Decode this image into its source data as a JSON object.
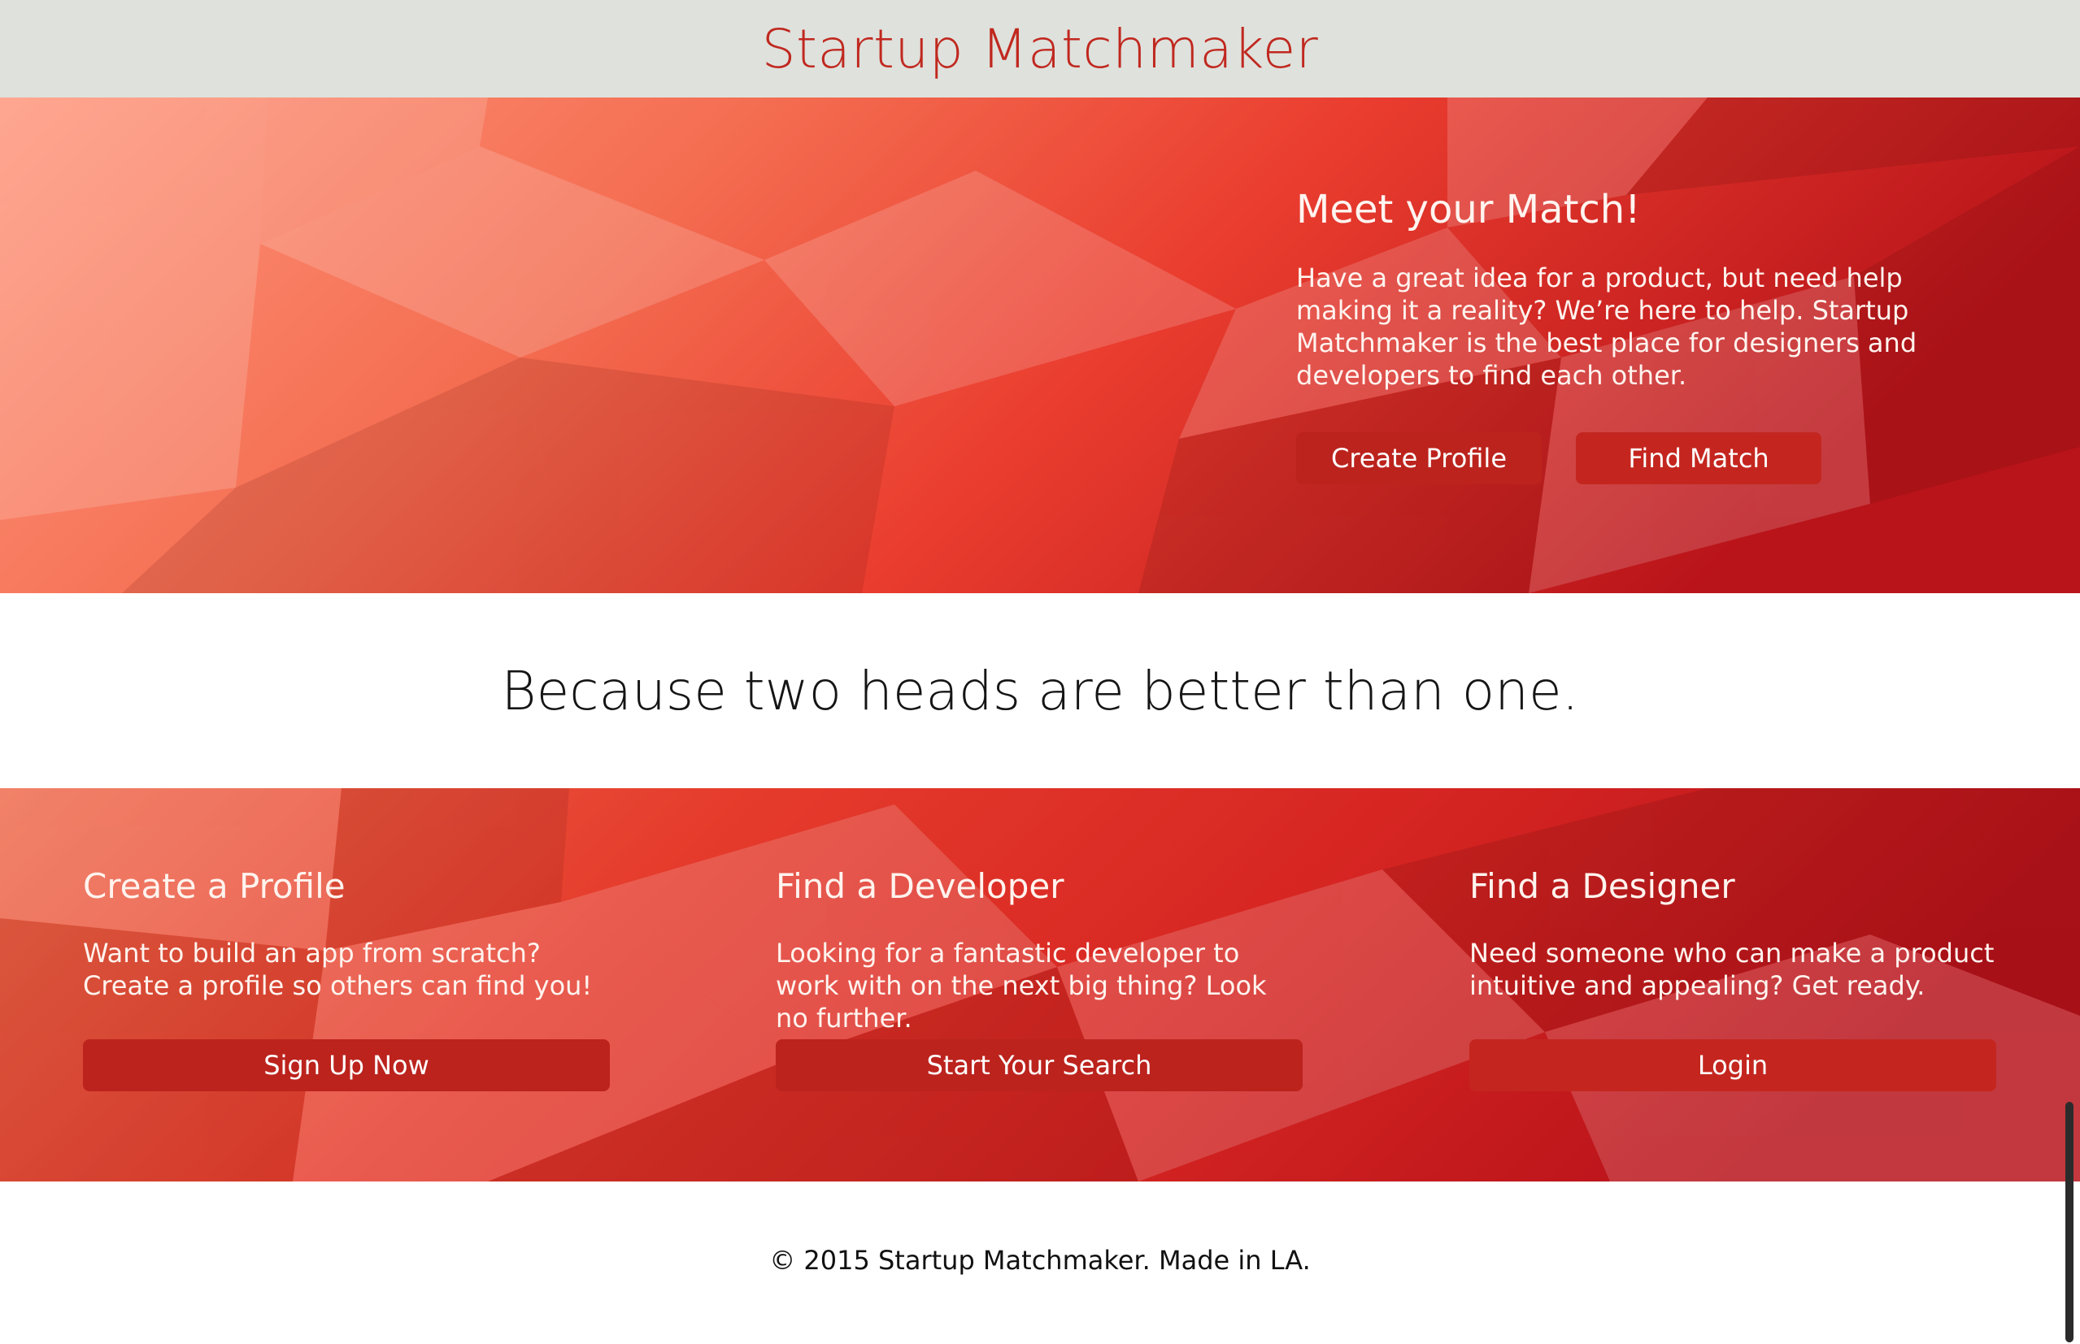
{
  "header": {
    "title": "Startup Matchmaker"
  },
  "hero": {
    "heading": "Meet your Match!",
    "text": "Have a great idea for a product, but need help making it a reality? We’re here to help. Startup Matchmaker is the best place for designers and developers to find each other.",
    "buttons": {
      "create_profile": "Create Profile",
      "find_match": "Find Match"
    }
  },
  "tagline": "Because two heads are better than one.",
  "features": [
    {
      "title": "Create a Profile",
      "text": "Want to build an app from scratch? Create a profile so others can find you!",
      "button": "Sign Up Now"
    },
    {
      "title": "Find a Developer",
      "text": "Looking for a fantastic developer to work with on the next big thing? Look no further.",
      "button": "Start Your Search"
    },
    {
      "title": "Find a Designer",
      "text": "Need someone who can make a product intuitive and appealing? Get ready.",
      "button": "Login"
    }
  ],
  "footer": {
    "text": "© 2015 Startup Matchmaker. Made in LA."
  },
  "colors": {
    "header_bg": "#dfe1dc",
    "title_red": "#c0281f",
    "button_red": "#bc231d",
    "hero_light": "#ff957a",
    "hero_dark": "#b31118"
  }
}
